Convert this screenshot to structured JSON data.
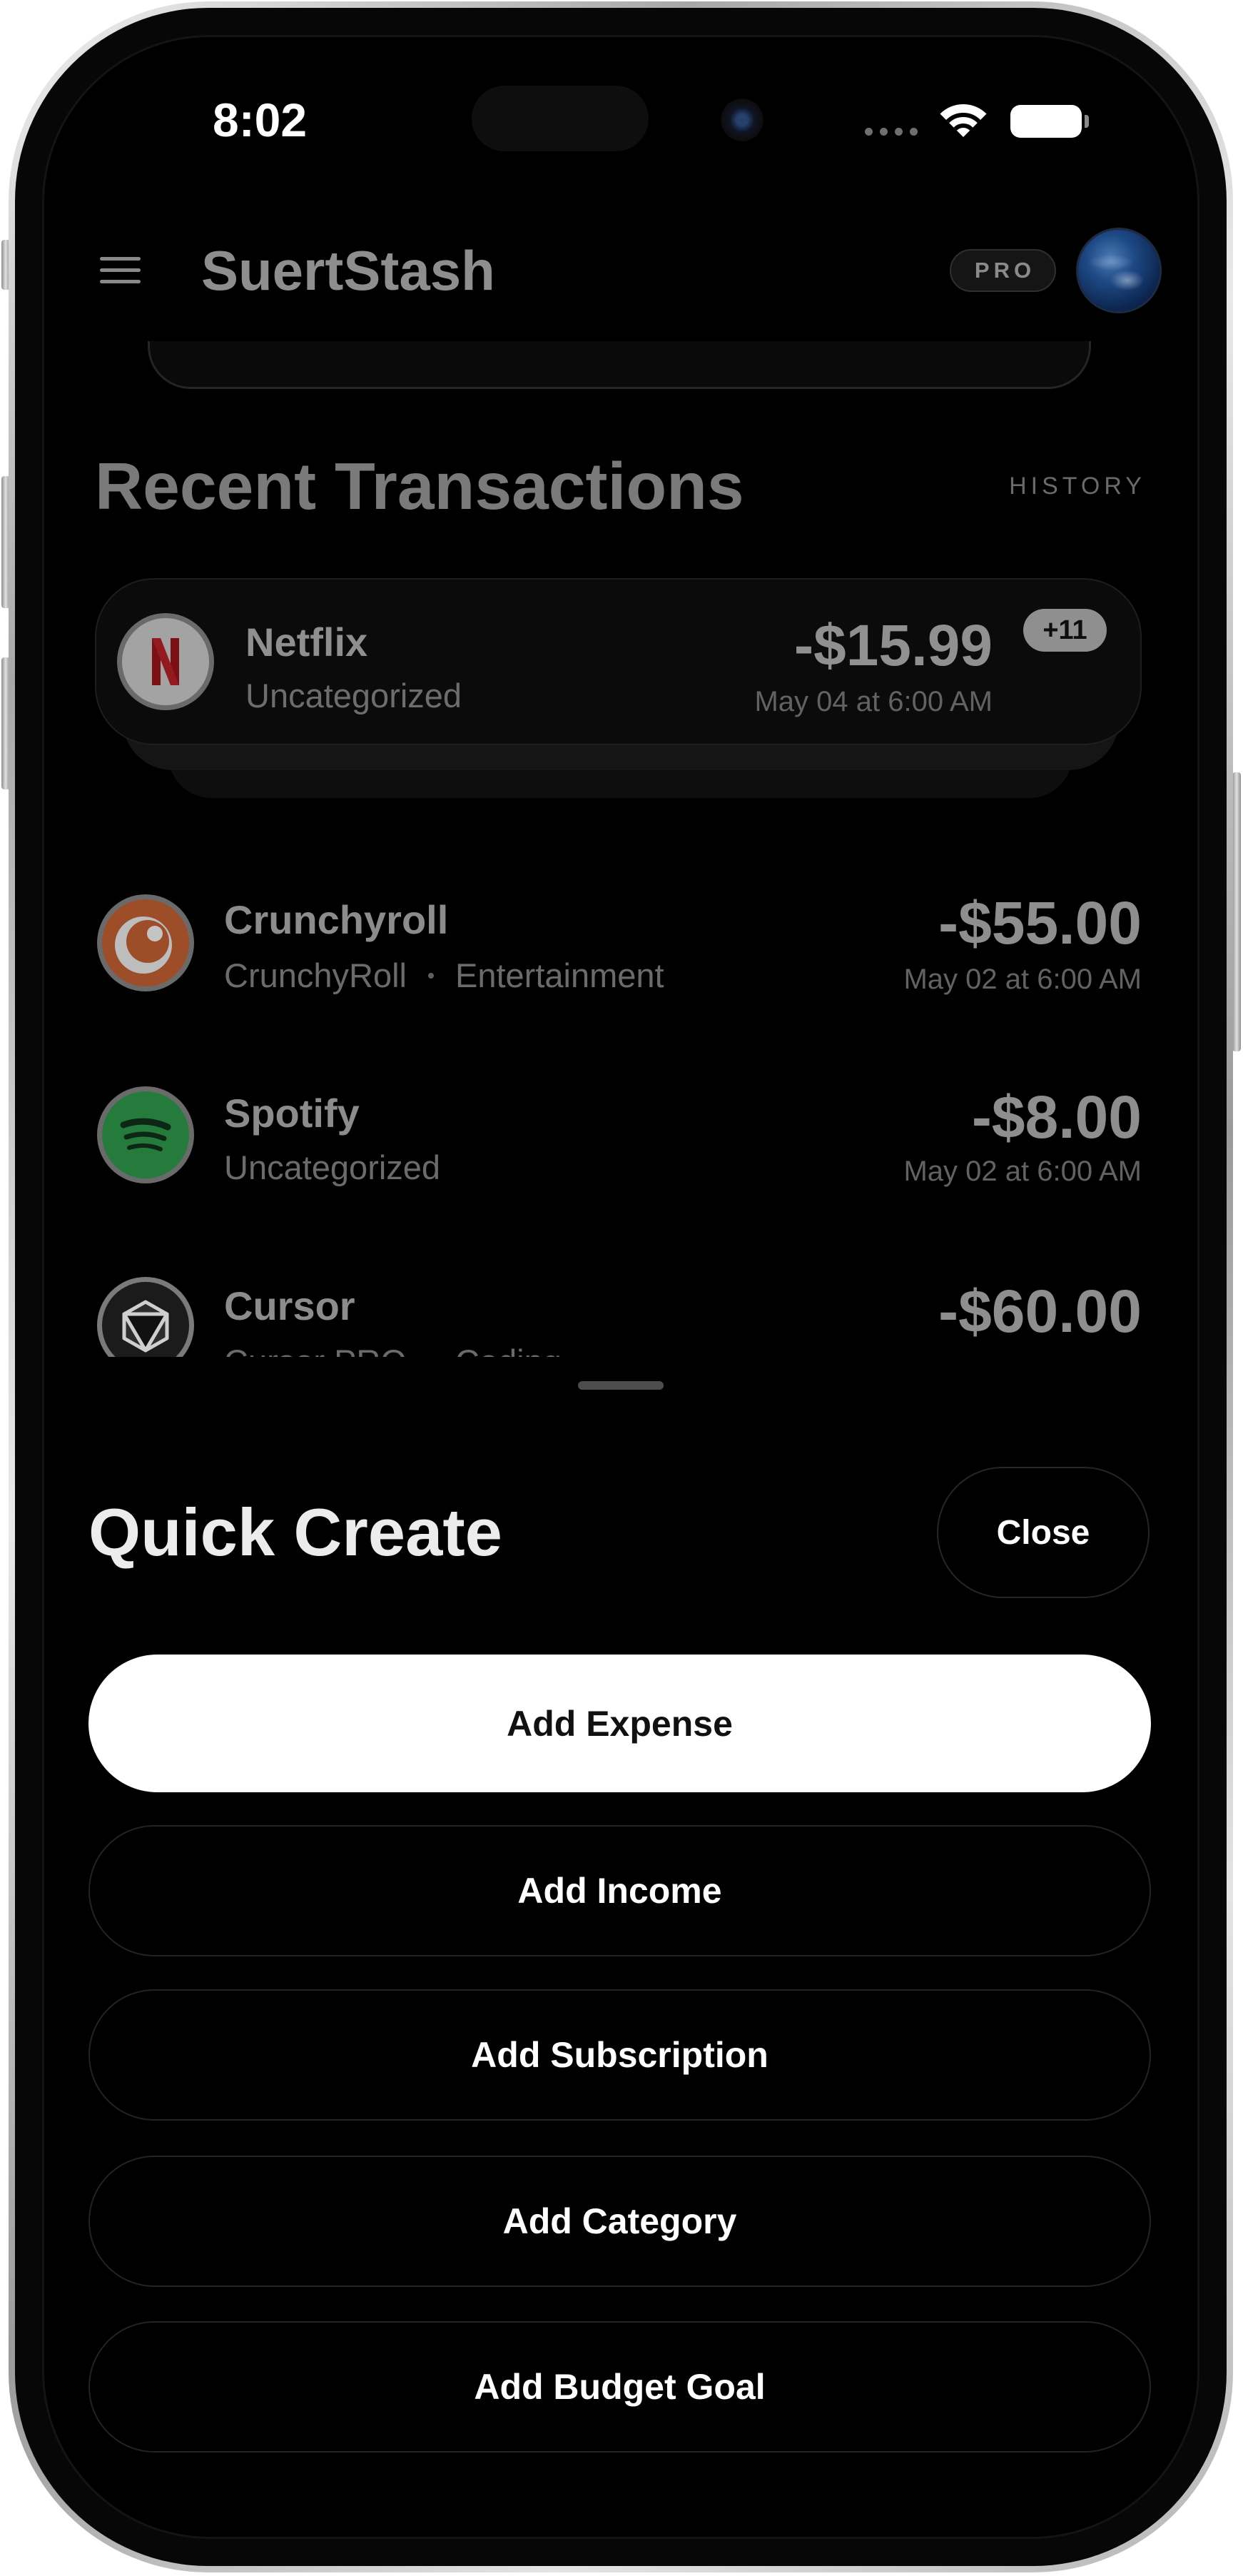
{
  "status_bar": {
    "time": "8:02",
    "icons": [
      "cellular-signal-icon",
      "wifi-icon",
      "battery-icon"
    ]
  },
  "header": {
    "menu_icon": "hamburger-menu-icon",
    "app_title": "SuertStash",
    "plan_badge": "PRO",
    "avatar": "profile-avatar"
  },
  "recent_transactions": {
    "title": "Recent Transactions",
    "history_link": "HISTORY",
    "featured": {
      "icon": "netflix-logo",
      "name": "Netflix",
      "category": "Uncategorized",
      "amount": "-$15.99",
      "date": "May 04 at 6:00 AM",
      "more_count": "+11"
    },
    "items": [
      {
        "icon": "crunchyroll-logo",
        "name": "Crunchyroll",
        "merchant": "CrunchyRoll",
        "category": "Entertainment",
        "amount": "-$55.00",
        "date": "May 02 at 6:00 AM"
      },
      {
        "icon": "spotify-logo",
        "name": "Spotify",
        "category": "Uncategorized",
        "amount": "-$8.00",
        "date": "May 02 at 6:00 AM"
      },
      {
        "icon": "cursor-logo",
        "name": "Cursor",
        "merchant": "Cursor PRO",
        "category": "Coding",
        "amount": "-$60.00"
      }
    ]
  },
  "quick_create": {
    "title": "Quick Create",
    "close_label": "Close",
    "actions": [
      {
        "label": "Add Expense"
      },
      {
        "label": "Add Income"
      },
      {
        "label": "Add Subscription"
      },
      {
        "label": "Add Category"
      },
      {
        "label": "Add Budget Goal"
      }
    ]
  },
  "colors": {
    "screen_background": "#000000",
    "primary_action_background": "#ffffff",
    "primary_action_text": "#111111",
    "secondary_action_text": "#ffffff",
    "dimmed_text": "#8c8c8c"
  }
}
